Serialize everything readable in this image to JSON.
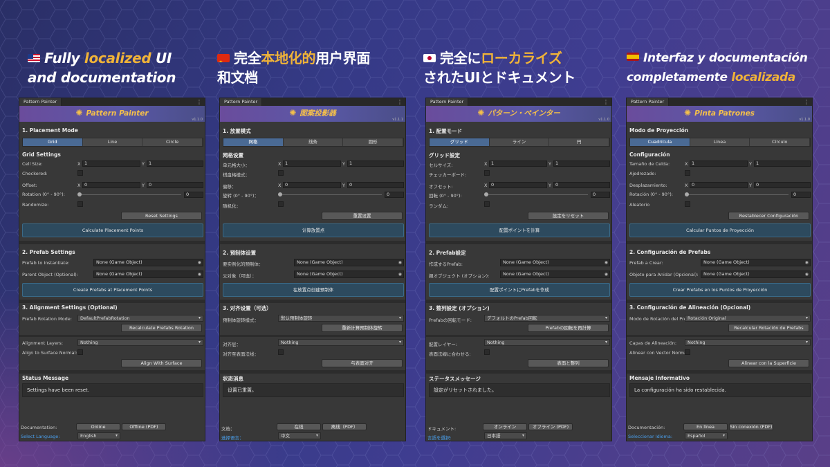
{
  "headings": [
    {
      "flag": "us",
      "pre": "Fully ",
      "hl": "localized",
      "post": " UI",
      "line2": "and documentation",
      "italic": true
    },
    {
      "flag": "cn",
      "pre": "完全",
      "hl": "本地化的",
      "post": "用户界面",
      "line2": "和文档",
      "italic": false
    },
    {
      "flag": "jp",
      "pre": "完全に",
      "hl": "ローカライズ",
      "post": "",
      "line2": "されたUIとドキュメント",
      "italic": false
    },
    {
      "flag": "es",
      "pre": "Interfaz y documentación",
      "hl": "",
      "post": "",
      "line2pre": "completamente ",
      "line2hl": "localizada",
      "italic": true
    }
  ],
  "windows": [
    {
      "tab": "Pattern Painter",
      "title": "Pattern Painter",
      "version": "v1.1.0",
      "placement_mode": "1. Placement Mode",
      "modes": [
        "Grid",
        "Line",
        "Circle"
      ],
      "grid_settings": "Grid Settings",
      "cell_size": "Cell Size:",
      "checkered": "Checkered:",
      "offset": "Offset:",
      "rotation": "Rotation (0° - 90°):",
      "randomize": "Randomize:",
      "x": "X",
      "y": "Y",
      "one": "1",
      "zero": "0",
      "reset": "Reset Settings",
      "calc": "Calculate Placement Points",
      "prefab_settings": "2. Prefab Settings",
      "prefab_to_instantiate": "Prefab to Instantiate:",
      "parent_object": "Parent Object (Optional):",
      "none_go": "None (Game Object)",
      "create": "Create Prefabs at Placement Points",
      "align_settings": "3. Alignment Settings (Optional)",
      "prefab_rot_mode": "Prefab Rotation Mode:",
      "rot_mode_value": "DefaultPrefabRotation",
      "recalc": "Recalculate Prefabs Rotation",
      "align_layers": "Alignment Layers:",
      "layers_value": "Nothing",
      "align_normal": "Align to Surface Normal:",
      "align_btn": "Align With Surface",
      "status_title": "Status Message",
      "status_msg": "Settings have been reset.",
      "doc": "Documentation:",
      "online": "Online",
      "offline": "Offline (PDF)",
      "select_lang": "Select Language:",
      "lang": "English"
    },
    {
      "tab": "Pattern Painter",
      "title": "图案投影器",
      "version": "v1.1.1",
      "placement_mode": "1. 放置模式",
      "modes": [
        "网格",
        "线条",
        "圆形"
      ],
      "grid_settings": "网格设置",
      "cell_size": "单元格大小：",
      "checkered": "棋盘格模式：",
      "offset": "偏移：",
      "rotation": "旋转 (0° - 90°)：",
      "randomize": "随机化：",
      "x": "X",
      "y": "Y",
      "one": "1",
      "zero": "0",
      "reset": "重置设置",
      "calc": "计算放置点",
      "prefab_settings": "2. 预制体设置",
      "prefab_to_instantiate": "要实例化的预制体：",
      "parent_object": "父对象（可选）：",
      "none_go": "None (Game Object)",
      "create": "在放置点创建预制体",
      "align_settings": "3. 对齐设置（可选）",
      "prefab_rot_mode": "预制体旋转模式：",
      "rot_mode_value": "默认预制体旋转",
      "recalc": "重新计算预制体旋转",
      "align_layers": "对齐层：",
      "layers_value": "Nothing",
      "align_normal": "对齐至表面法线：",
      "align_btn": "与表面对齐",
      "status_title": "状态消息",
      "status_msg": "设置已重置。",
      "doc": "文档：",
      "online": "在线",
      "offline": "离线（PDF）",
      "select_lang": "选择语言：",
      "lang": "中文"
    },
    {
      "tab": "Pattern Painter",
      "title": "パターン・ペインター",
      "version": "v1.1.0",
      "placement_mode": "1. 配置モード",
      "modes": [
        "グリッド",
        "ライン",
        "円"
      ],
      "grid_settings": "グリッド設定",
      "cell_size": "セルサイズ:",
      "checkered": "チェッカーボード:",
      "offset": "オフセット:",
      "rotation": "回転 (0° - 90°):",
      "randomize": "ランダム:",
      "x": "X",
      "y": "Y",
      "one": "1",
      "zero": "0",
      "reset": "設定をリセット",
      "calc": "配置ポイントを計算",
      "prefab_settings": "2. Prefab設定",
      "prefab_to_instantiate": "作成するPrefab:",
      "parent_object": "親オブジェクト (オプション):",
      "none_go": "None (Game Object)",
      "create": "配置ポイントにPrefabを作成",
      "align_settings": "3. 整列設定 (オプション)",
      "prefab_rot_mode": "Prefabの回転モード:",
      "rot_mode_value": "デフォルトのPrefab回転",
      "recalc": "Prefabの回転を再計算",
      "align_layers": "配置レイヤー:",
      "layers_value": "Nothing",
      "align_normal": "表面法線に合わせる:",
      "align_btn": "表面と整列",
      "status_title": "ステータスメッセージ",
      "status_msg": "設定がリセットされました。",
      "doc": "ドキュメント:",
      "online": "オンライン",
      "offline": "オフライン (PDF)",
      "select_lang": "言語を選択:",
      "lang": "日本語"
    },
    {
      "tab": "Pattern Painter",
      "title": "Pinta Patrones",
      "version": "v1.1.0",
      "placement_mode": "Modo de Proyección",
      "modes": [
        "Cuadrícula",
        "Línea",
        "Círculo"
      ],
      "grid_settings": "Configuración",
      "cell_size": "Tamaño de Celda:",
      "checkered": "Ajedrezado:",
      "offset": "Desplazamiento:",
      "rotation": "Rotación (0° - 90°):",
      "randomize": "Aleatorio",
      "x": "X",
      "y": "Y",
      "one": "1",
      "zero": "0",
      "reset": "Restablecer Configuración",
      "calc": "Calcular Puntos de Proyección",
      "prefab_settings": "2. Configuración de Prefabs",
      "prefab_to_instantiate": "Prefab a Crear:",
      "parent_object": "Objeto para Anidar (Opcional):",
      "none_go": "None (Game Object)",
      "create": "Crear Prefabs en los Puntos de Proyección",
      "align_settings": "3. Configuración de Alineación (Opcional)",
      "prefab_rot_mode": "Modo de Rotación del Pref",
      "rot_mode_value": "Rotación Original",
      "recalc": "Recalcular Rotación de Prefabs",
      "align_layers": "Capas de Alineación:",
      "layers_value": "Nothing",
      "align_normal": "Alinear con Vector Normal",
      "align_btn": "Alinear con la Superficie",
      "status_title": "Mensaje Informativo",
      "status_msg": "La configuración ha sido restablecida.",
      "doc": "Documentación:",
      "online": "En línea",
      "offline": "Sin conexión (PDF)",
      "select_lang": "Seleccionar Idioma:",
      "lang": "Español"
    }
  ]
}
